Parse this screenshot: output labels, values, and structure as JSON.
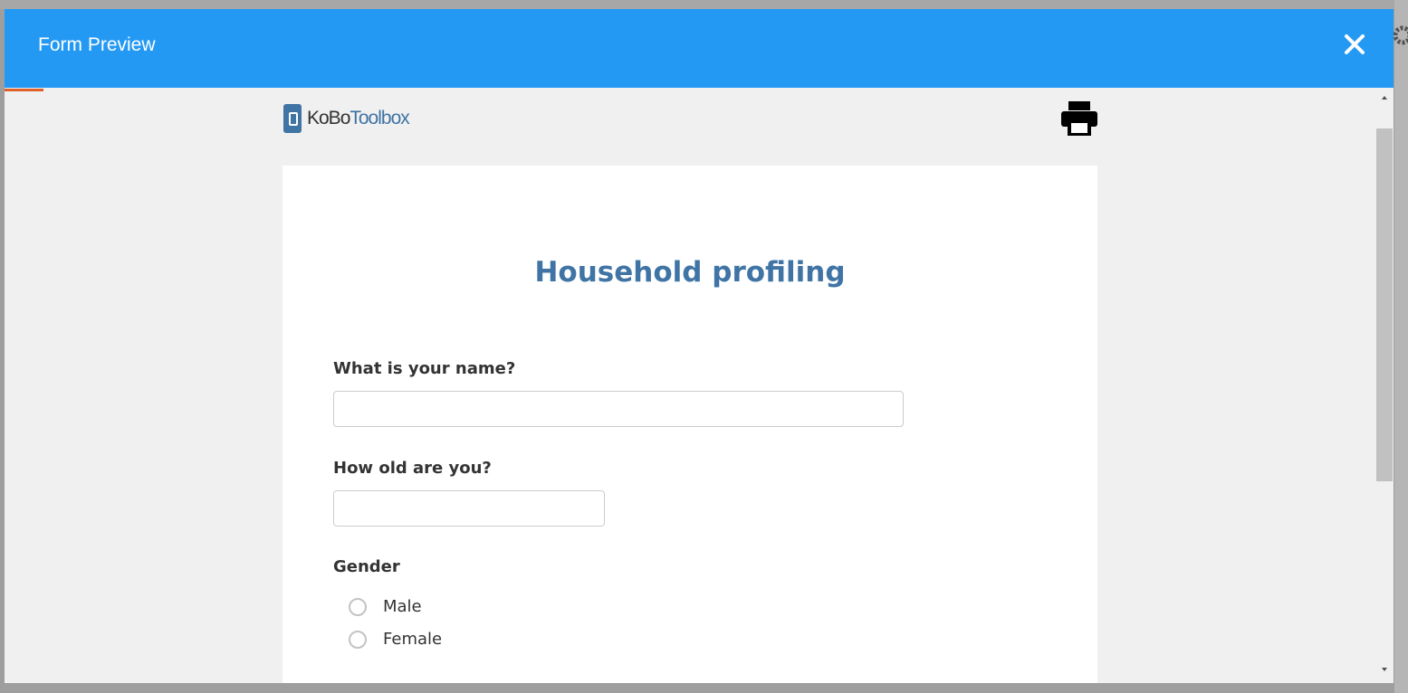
{
  "modal": {
    "title": "Form Preview",
    "close_icon": "close-x-icon"
  },
  "logo": {
    "part1": "KoBo",
    "part2": "Toolbox"
  },
  "print_icon": "print-icon",
  "colors": {
    "header": "#2499f4",
    "title_blue": "#3f74a5",
    "progress": "#e0612a"
  },
  "form": {
    "title": "Household profiling",
    "questions": [
      {
        "label": "What is your name?",
        "type": "text",
        "value": ""
      },
      {
        "label": "How old are you?",
        "type": "integer",
        "value": ""
      },
      {
        "label": "Gender",
        "type": "select_one",
        "options": [
          "Male",
          "Female"
        ],
        "selected": null
      }
    ]
  }
}
